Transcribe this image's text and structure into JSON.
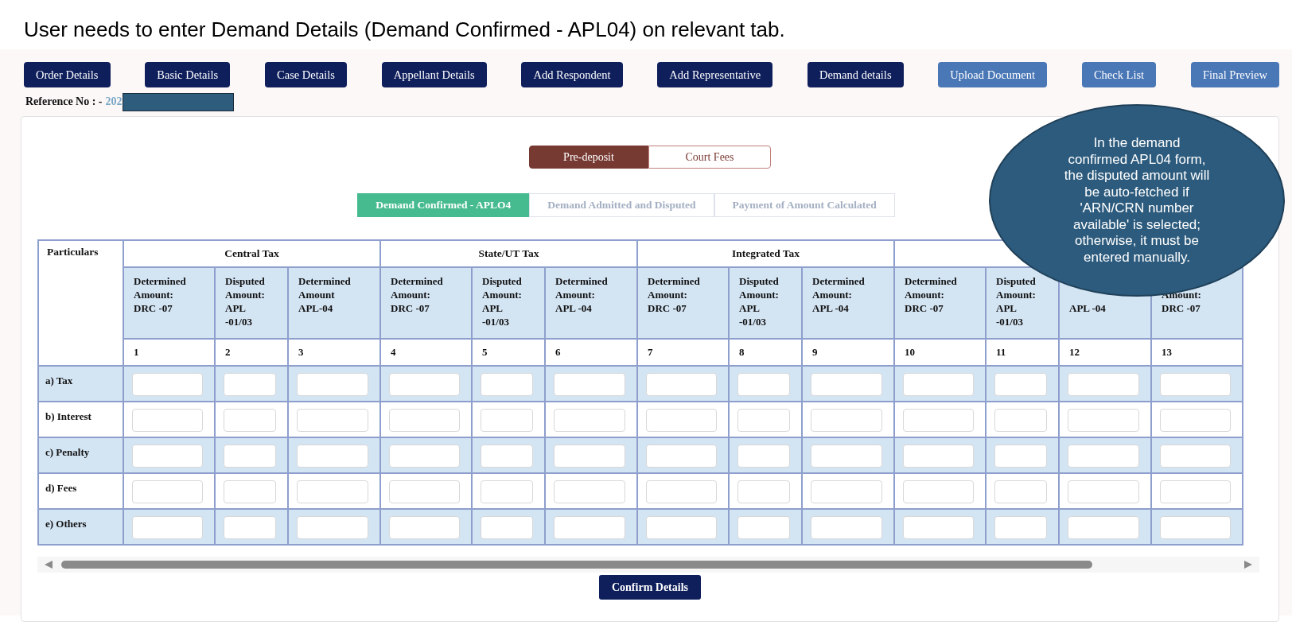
{
  "instruction": "User needs to enter Demand Details (Demand Confirmed - APL04) on relevant tab.",
  "nav_buttons": [
    {
      "label": "Order Details",
      "kind": "primary"
    },
    {
      "label": "Basic Details",
      "kind": "primary"
    },
    {
      "label": "Case Details",
      "kind": "primary"
    },
    {
      "label": "Appellant Details",
      "kind": "primary"
    },
    {
      "label": "Add Respondent",
      "kind": "primary"
    },
    {
      "label": "Add Representative",
      "kind": "primary"
    },
    {
      "label": "Demand details",
      "kind": "primary"
    },
    {
      "label": "Upload Document",
      "kind": "secondary"
    },
    {
      "label": "Check List",
      "kind": "secondary"
    },
    {
      "label": "Final Preview",
      "kind": "secondary"
    }
  ],
  "reference": {
    "label": "Reference No : -",
    "value": "202"
  },
  "deposit_toggle": [
    {
      "label": "Pre-deposit",
      "selected": true
    },
    {
      "label": "Court Fees",
      "selected": false
    }
  ],
  "demand_tabs": [
    {
      "label": "Demand Confirmed - APLO4",
      "selected": true
    },
    {
      "label": "Demand Admitted and Disputed",
      "selected": false
    },
    {
      "label": "Payment of Amount Calculated",
      "selected": false
    }
  ],
  "table": {
    "corner": "Particulars",
    "groups": [
      "Central Tax",
      "State/UT Tax",
      "Integrated Tax"
    ],
    "columns": [
      {
        "lines": [
          "Determined",
          "Amount:",
          "DRC -07"
        ],
        "number": "1"
      },
      {
        "lines": [
          "Disputed",
          "Amount:",
          "APL",
          "-01/03"
        ],
        "number": "2"
      },
      {
        "lines": [
          "Determined",
          "Amount",
          "APL-04"
        ],
        "number": "3"
      },
      {
        "lines": [
          "Determined",
          "Amount:",
          "DRC -07"
        ],
        "number": "4"
      },
      {
        "lines": [
          "Disputed",
          "Amount:",
          "APL",
          "-01/03"
        ],
        "number": "5"
      },
      {
        "lines": [
          "Determined",
          "Amount:",
          "APL -04"
        ],
        "number": "6"
      },
      {
        "lines": [
          "Determined",
          "Amount:",
          "DRC -07"
        ],
        "number": "7"
      },
      {
        "lines": [
          "Disputed",
          "Amount:",
          "APL",
          "-01/03"
        ],
        "number": "8"
      },
      {
        "lines": [
          "Determined",
          "Amount:",
          "APL -04"
        ],
        "number": "9"
      },
      {
        "lines": [
          "Determined",
          "Amount:",
          "DRC -07"
        ],
        "number": "10"
      },
      {
        "lines": [
          "Disputed",
          "Amount:",
          "APL",
          "-01/03"
        ],
        "number": "11"
      },
      {
        "lines": [
          "APL -04"
        ],
        "number": "12",
        "covered": true
      },
      {
        "lines": [
          "Amount:",
          "DRC -07"
        ],
        "number": "13",
        "covered": true
      }
    ],
    "rows": [
      {
        "label": "a) Tax"
      },
      {
        "label": "b) Interest"
      },
      {
        "label": "c) Penalty"
      },
      {
        "label": "d) Fees"
      },
      {
        "label": "e) Others"
      }
    ]
  },
  "confirm_button": "Confirm Details",
  "callout": {
    "lines": [
      "In the demand",
      "confirmed APL04 form,",
      "the disputed amount will",
      "be auto-fetched if",
      "'ARN/CRN number",
      "available' is selected;",
      "otherwise, it must be",
      "entered manually."
    ]
  }
}
